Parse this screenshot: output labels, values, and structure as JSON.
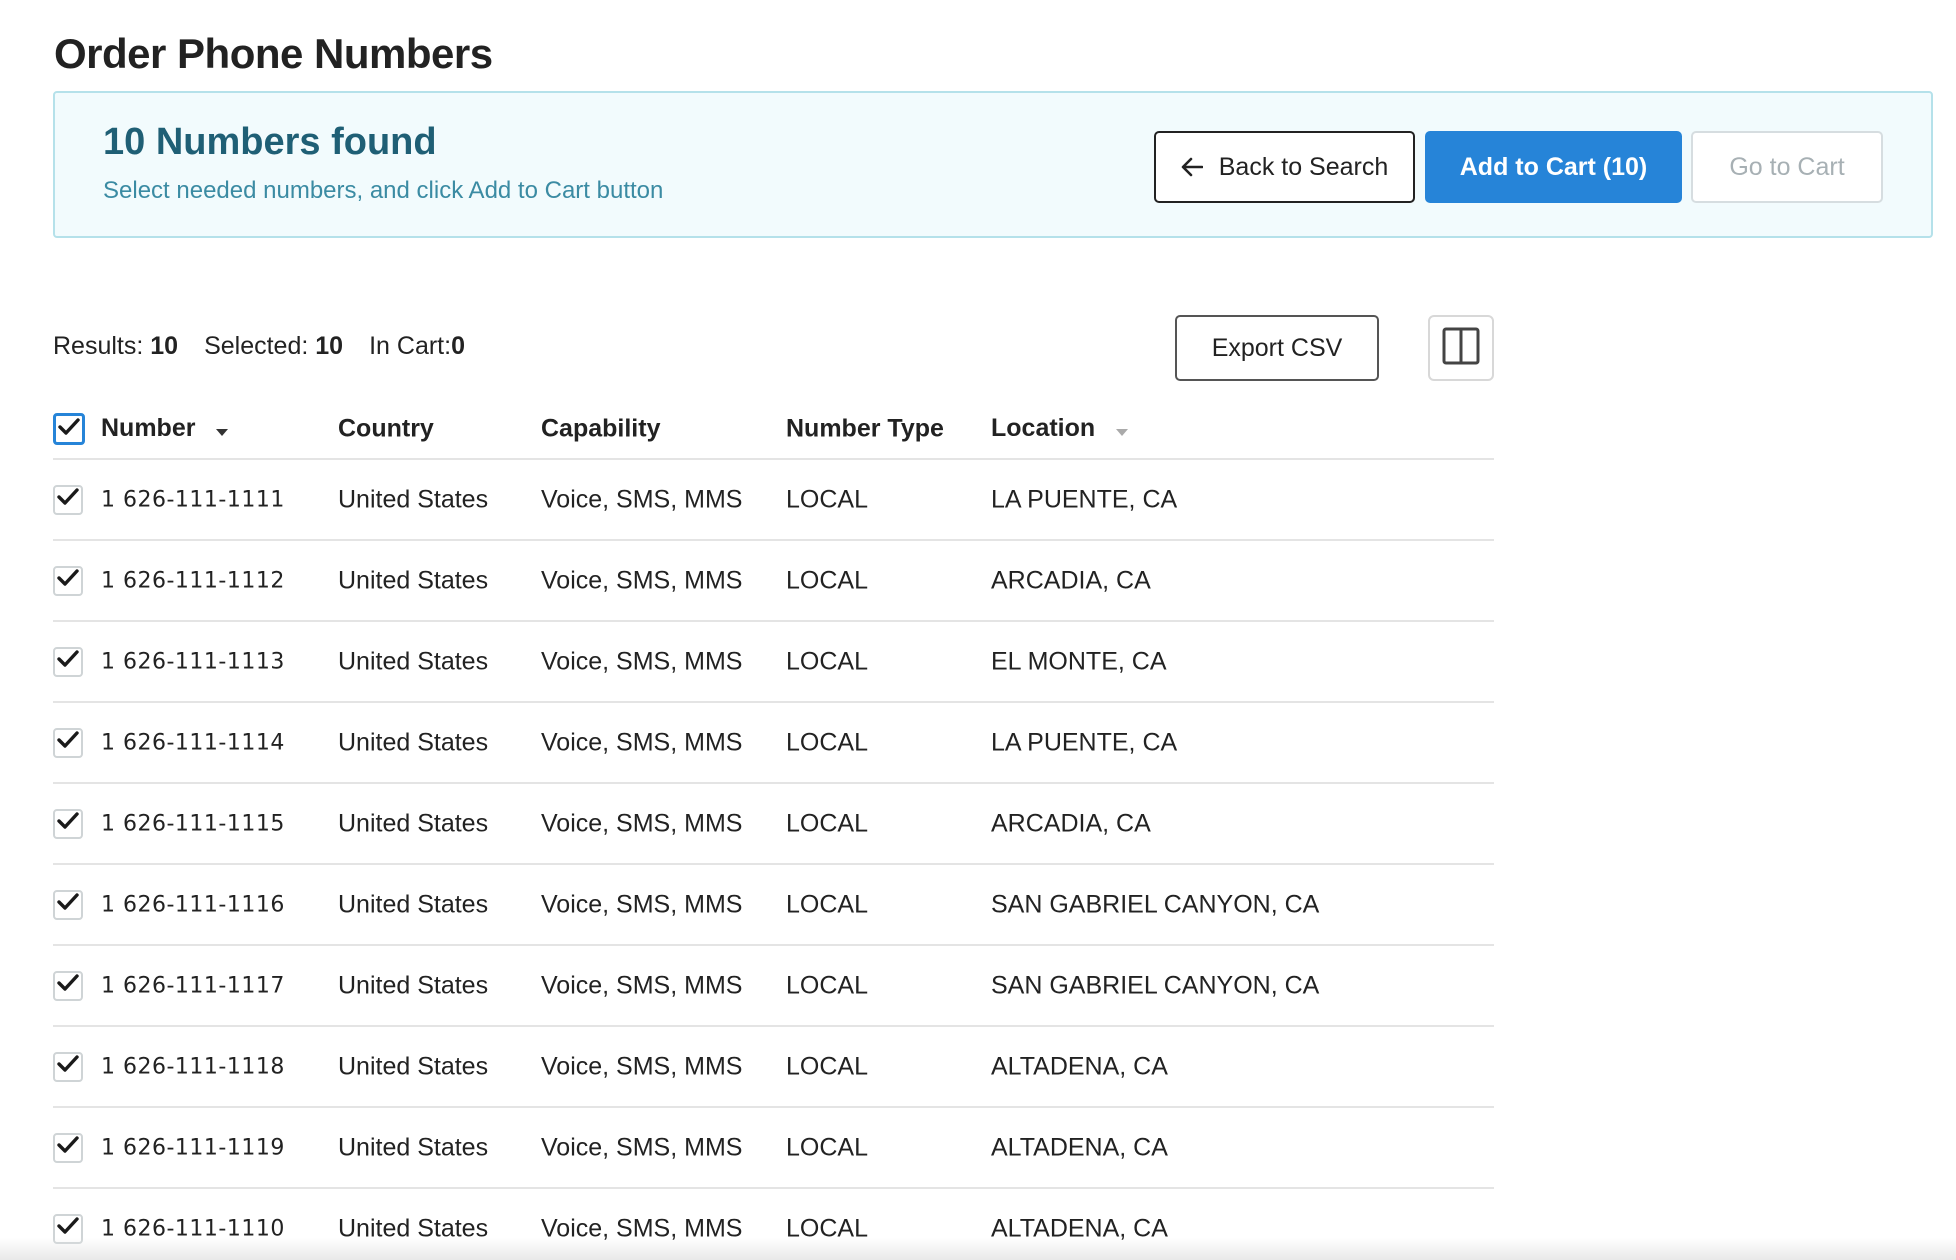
{
  "page": {
    "title": "Order Phone Numbers"
  },
  "banner": {
    "title": "10 Numbers found",
    "subtitle": "Select needed numbers, and click Add to Cart button",
    "back_label": "Back to Search",
    "add_to_cart_label": "Add to Cart (10)",
    "go_to_cart_label": "Go to Cart"
  },
  "stats": {
    "results_label": "Results:",
    "results_value": "10",
    "selected_label": "Selected:",
    "selected_value": "10",
    "in_cart_label": "In Cart:",
    "in_cart_value": "0"
  },
  "toolbar": {
    "export_label": "Export CSV"
  },
  "table": {
    "headers": {
      "number": "Number",
      "country": "Country",
      "capability": "Capability",
      "type": "Number Type",
      "location": "Location"
    },
    "rows": [
      {
        "number": "1 626-111-1111",
        "country": "United States",
        "capability": "Voice, SMS, MMS",
        "type": "LOCAL",
        "location": "LA PUENTE, CA",
        "checked": true
      },
      {
        "number": "1 626-111-1112",
        "country": "United States",
        "capability": "Voice, SMS, MMS",
        "type": "LOCAL",
        "location": "ARCADIA, CA",
        "checked": true
      },
      {
        "number": "1 626-111-1113",
        "country": "United States",
        "capability": "Voice, SMS, MMS",
        "type": "LOCAL",
        "location": "EL MONTE, CA",
        "checked": true
      },
      {
        "number": "1 626-111-1114",
        "country": "United States",
        "capability": "Voice, SMS, MMS",
        "type": "LOCAL",
        "location": "LA PUENTE, CA",
        "checked": true
      },
      {
        "number": "1 626-111-1115",
        "country": "United States",
        "capability": "Voice, SMS, MMS",
        "type": "LOCAL",
        "location": "ARCADIA, CA",
        "checked": true
      },
      {
        "number": "1 626-111-1116",
        "country": "United States",
        "capability": "Voice, SMS, MMS",
        "type": "LOCAL",
        "location": "SAN GABRIEL CANYON, CA",
        "checked": true
      },
      {
        "number": "1 626-111-1117",
        "country": "United States",
        "capability": "Voice, SMS, MMS",
        "type": "LOCAL",
        "location": "SAN GABRIEL CANYON, CA",
        "checked": true
      },
      {
        "number": "1 626-111-1118",
        "country": "United States",
        "capability": "Voice, SMS, MMS",
        "type": "LOCAL",
        "location": "ALTADENA, CA",
        "checked": true
      },
      {
        "number": "1 626-111-1119",
        "country": "United States",
        "capability": "Voice, SMS, MMS",
        "type": "LOCAL",
        "location": "ALTADENA, CA",
        "checked": true
      },
      {
        "number": "1 626-111-1110",
        "country": "United States",
        "capability": "Voice, SMS, MMS",
        "type": "LOCAL",
        "location": "ALTADENA, CA",
        "checked": true
      }
    ]
  },
  "colors": {
    "primary": "#2684d8",
    "banner_bg": "#f2fbfd",
    "banner_border": "#b5e1ea",
    "banner_title": "#1f5f75",
    "banner_sub": "#3b8ba3"
  },
  "icons": {
    "back": "arrow-left-icon",
    "columns": "columns-icon",
    "check": "check-icon",
    "sort": "caret-down-icon"
  }
}
